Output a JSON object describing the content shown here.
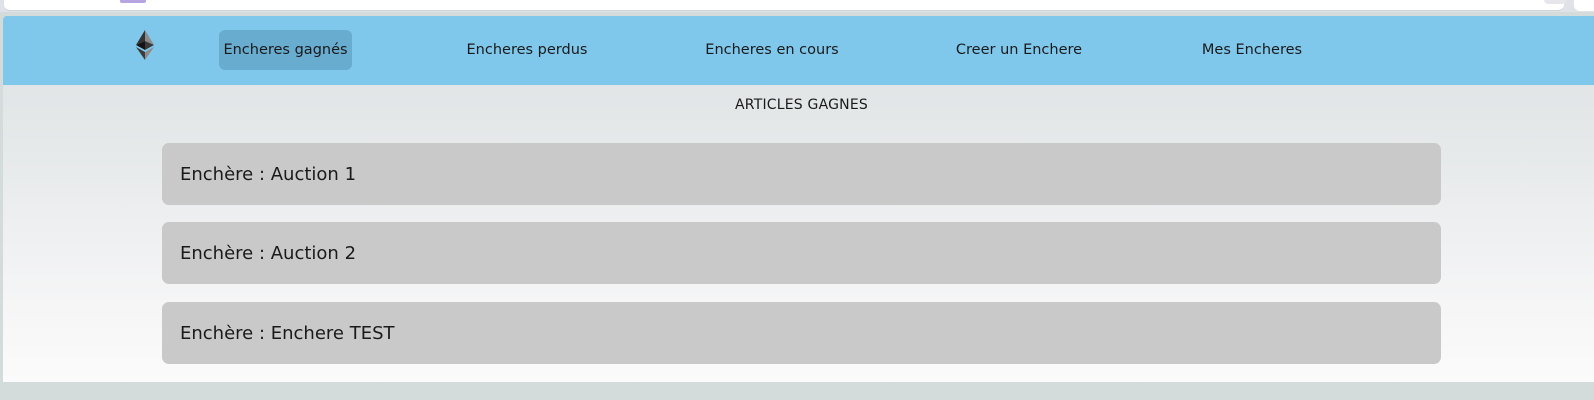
{
  "nav": {
    "logo_icon": "ethereum-logo-icon",
    "items": [
      {
        "label": "Encheres gagnés",
        "active": true
      },
      {
        "label": "Encheres perdus",
        "active": false
      },
      {
        "label": "Encheres en cours",
        "active": false
      },
      {
        "label": "Creer un Enchere",
        "active": false
      },
      {
        "label": "Mes Encheres",
        "active": false
      }
    ]
  },
  "main": {
    "title": "ARTICLES GAGNES",
    "auctions": [
      {
        "label": "Enchère : Auction 1"
      },
      {
        "label": "Enchère : Auction 2"
      },
      {
        "label": "Enchère : Enchere TEST"
      }
    ]
  },
  "colors": {
    "navbar": "#7fc8ec",
    "nav_active": "#68acd0",
    "card": "#c9c9c9"
  }
}
